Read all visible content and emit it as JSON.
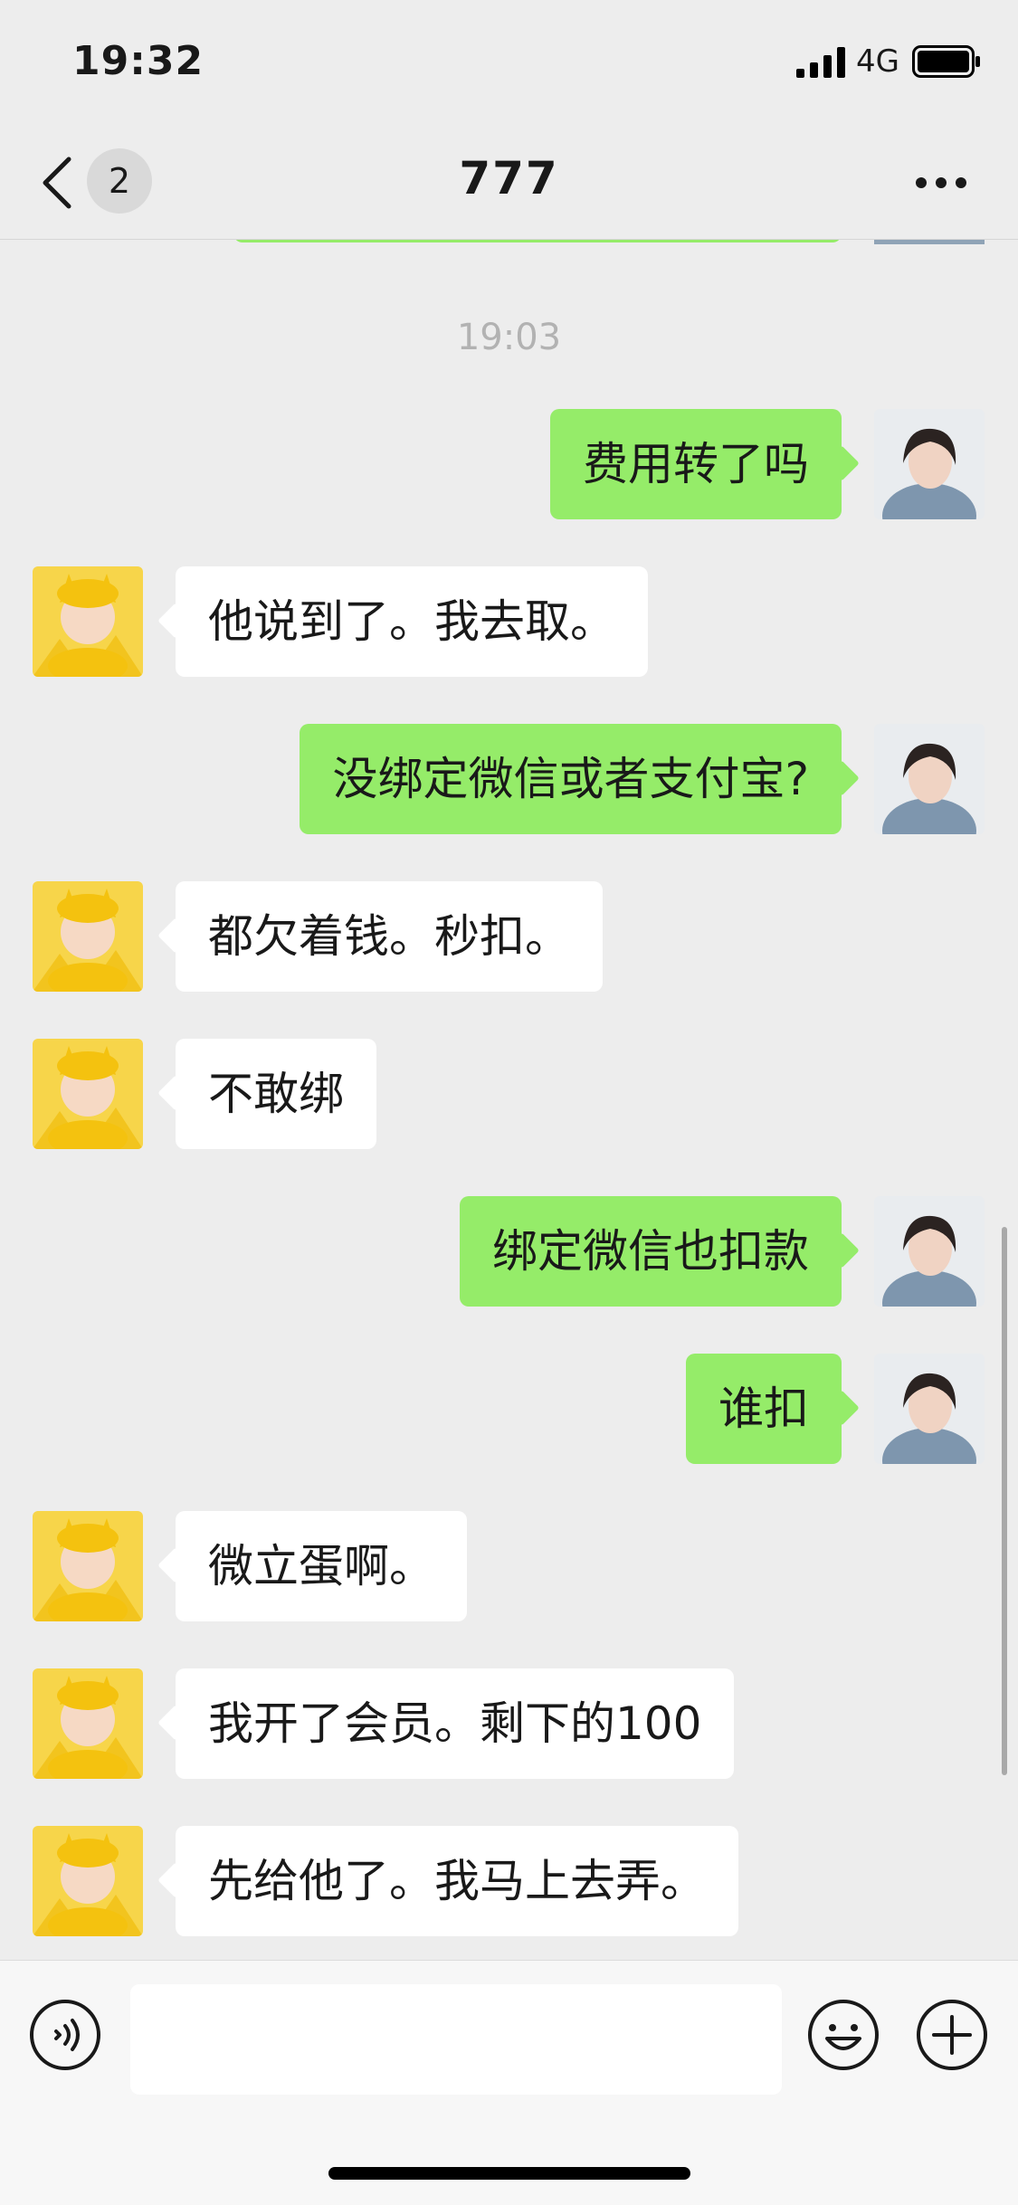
{
  "status_bar": {
    "time": "19:32",
    "network": "4G",
    "signal_icon": "signal-icon",
    "battery_icon": "battery-icon"
  },
  "nav": {
    "title": "777",
    "unread_count": "2",
    "back_icon": "chevron-left-icon",
    "more_icon": "more-icon"
  },
  "timestamp": "19:03",
  "messages": [
    {
      "side": "right",
      "text": "费用转了吗"
    },
    {
      "side": "left",
      "text": "他说到了。我去取。"
    },
    {
      "side": "right",
      "text": "没绑定微信或者支付宝?"
    },
    {
      "side": "left",
      "text": "都欠着钱。秒扣。"
    },
    {
      "side": "left",
      "text": "不敢绑"
    },
    {
      "side": "right",
      "text": "绑定微信也扣款"
    },
    {
      "side": "right",
      "text": "谁扣"
    },
    {
      "side": "left",
      "text": "微立蛋啊。"
    },
    {
      "side": "left",
      "text": "我开了会员。剩下的100"
    },
    {
      "side": "left",
      "text": "先给他了。我马上去弄。"
    }
  ],
  "input_bar": {
    "text_value": "",
    "voice_icon": "voice-icon",
    "emoji_icon": "emoji-icon",
    "plus_icon": "plus-icon"
  },
  "colors": {
    "background": "#ededed",
    "self_bubble": "#95ec69",
    "other_bubble": "#ffffff"
  }
}
